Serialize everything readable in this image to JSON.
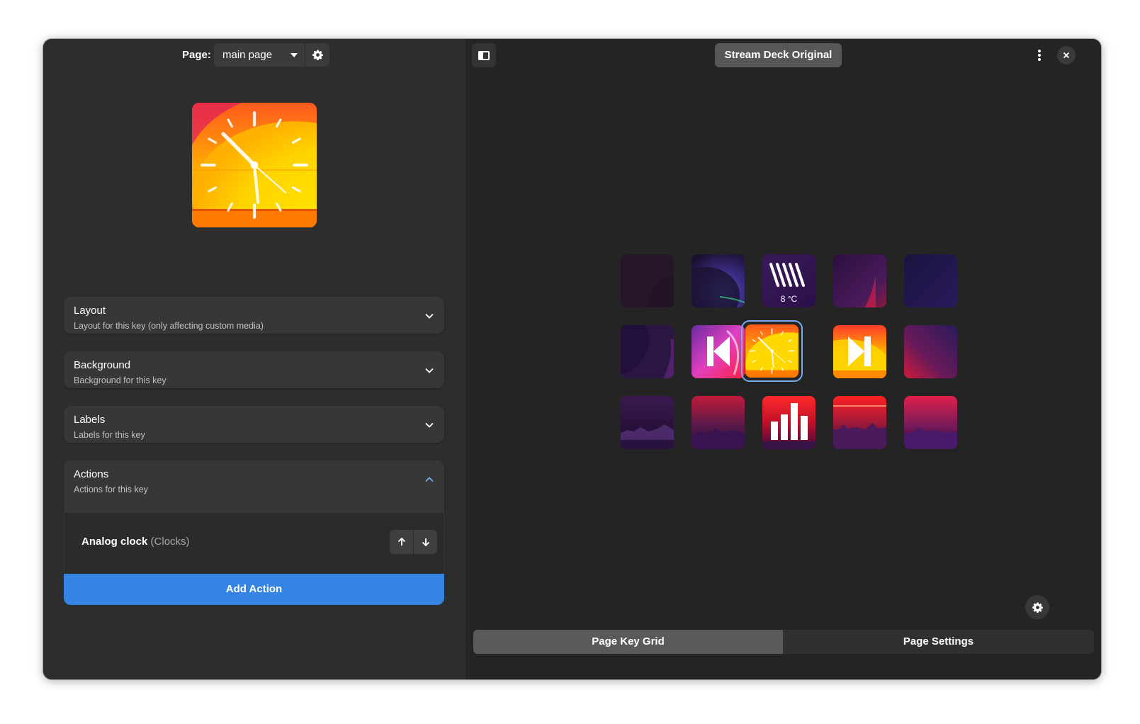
{
  "header": {
    "page_label": "Page:",
    "page_value": "main page"
  },
  "expanders": [
    {
      "title": "Layout",
      "subtitle": "Layout for this key (only affecting custom media)"
    },
    {
      "title": "Background",
      "subtitle": "Background for this key"
    },
    {
      "title": "Labels",
      "subtitle": "Labels for this key"
    },
    {
      "title": "Actions",
      "subtitle": "Actions for this key"
    }
  ],
  "actions": {
    "items": [
      {
        "name": "Analog clock",
        "category": "(Clocks)"
      }
    ],
    "add_label": "Add Action"
  },
  "deck": {
    "title": "Stream Deck Original",
    "weather_label": "8 °C"
  },
  "tabs": {
    "key_grid": "Page Key Grid",
    "settings": "Page Settings"
  },
  "colors": {
    "accent": "#3584e4",
    "selection": "#78aeed",
    "window_bg": "#242424",
    "sidebar_bg": "#2d2d2d"
  },
  "icons": [
    "gear-icon",
    "chevron-down-icon",
    "chevron-up-icon",
    "arrow-up-icon",
    "arrow-down-icon",
    "sidebar-icon",
    "kebab-menu-icon",
    "close-icon",
    "previous-track-icon",
    "next-track-icon",
    "equalizer-icon",
    "weather-icon",
    "clock-icon"
  ]
}
